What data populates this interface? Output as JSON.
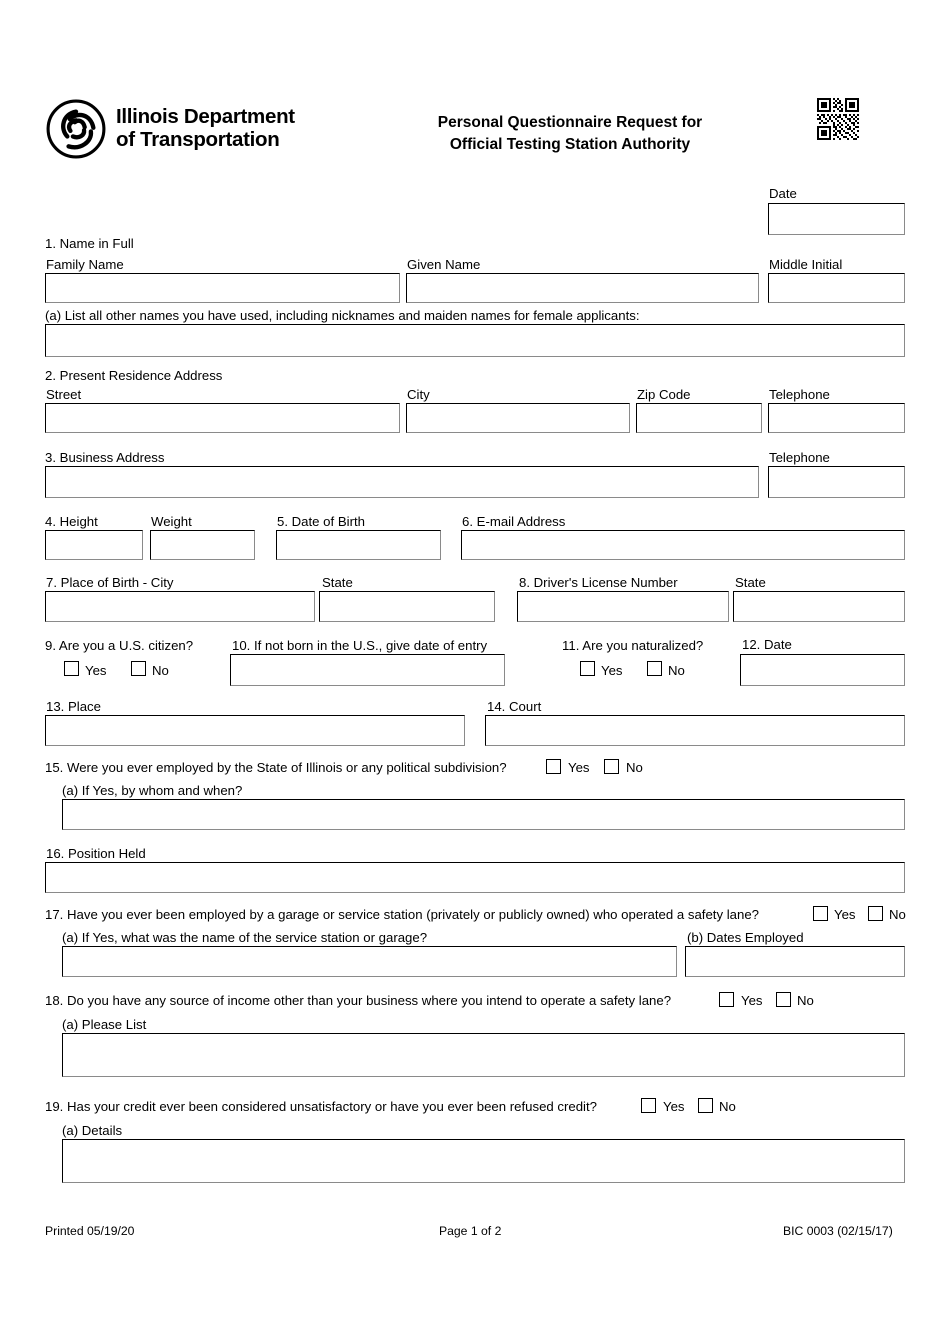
{
  "document": {
    "agency_line1": "Illinois Department",
    "agency_line2": "of Transportation",
    "title_line1": "Personal Questionnaire Request for",
    "title_line2": "Official Testing Station Authority",
    "logo_icon": "idot-trefoil-logo",
    "qr_icon": "qr-code"
  },
  "date_field": {
    "label": "Date",
    "value": ""
  },
  "q1": {
    "heading": "1. Name in Full",
    "family_label": "Family Name",
    "family_value": "",
    "given_label": "Given Name",
    "given_value": "",
    "middle_label": "Middle Initial",
    "middle_value": "",
    "a_label": "(a) List all other names you have used, including nicknames and maiden names for female applicants:",
    "a_value": ""
  },
  "q2": {
    "heading": "2. Present Residence Address",
    "street_label": "Street",
    "street_value": "",
    "city_label": "City",
    "city_value": "",
    "zip_label": "Zip Code",
    "zip_value": "",
    "phone_label": "Telephone",
    "phone_value": ""
  },
  "q3": {
    "heading": "3. Business Address",
    "address_value": "",
    "phone_label": "Telephone",
    "phone_value": ""
  },
  "q4": {
    "height_label": "4. Height",
    "height_value": "",
    "weight_label": "Weight",
    "weight_value": ""
  },
  "q5": {
    "label": "5. Date of Birth",
    "value": ""
  },
  "q6": {
    "label": "6. E-mail Address",
    "value": ""
  },
  "q7": {
    "city_label": "7. Place of Birth - City",
    "city_value": "",
    "state_label": "State",
    "state_value": ""
  },
  "q8": {
    "label": "8. Driver's License Number",
    "value": "",
    "state_label": "State",
    "state_value": ""
  },
  "q9": {
    "label": "9. Are you a U.S. citizen?",
    "yes_label": "Yes",
    "no_label": "No"
  },
  "q10": {
    "label": "10. If not born in the U.S., give date of entry",
    "value": ""
  },
  "q11": {
    "label": "11. Are you naturalized?",
    "yes_label": "Yes",
    "no_label": "No"
  },
  "q12": {
    "label": "12. Date",
    "value": ""
  },
  "q13": {
    "label": "13. Place",
    "value": ""
  },
  "q14": {
    "label": "14. Court",
    "value": ""
  },
  "q15": {
    "label": "15. Were you ever employed by the State of Illinois or any political subdivision?",
    "yes_label": "Yes",
    "no_label": "No",
    "a_label": "(a) If Yes, by whom and when?",
    "a_value": ""
  },
  "q16": {
    "label": "16. Position Held",
    "value": ""
  },
  "q17": {
    "label": "17. Have you ever been employed by a garage or service station (privately or publicly owned) who operated a safety lane?",
    "yes_label": "Yes",
    "no_label": "No",
    "a_label": "(a) If Yes, what was the name of the service station or garage?",
    "a_value": "",
    "b_label": "(b) Dates Employed",
    "b_value": ""
  },
  "q18": {
    "label": "18. Do you have any source of income other than your business where you intend to operate a safety lane?",
    "yes_label": "Yes",
    "no_label": "No",
    "a_label": "(a) Please List",
    "a_value": ""
  },
  "q19": {
    "label": "19. Has your credit ever been considered unsatisfactory or have you ever been refused credit?",
    "yes_label": "Yes",
    "no_label": "No",
    "a_label": "(a) Details",
    "a_value": ""
  },
  "footer": {
    "printed": "Printed 05/19/20",
    "page": "Page 1 of 2",
    "form_id": "BIC 0003 (02/15/17)"
  }
}
